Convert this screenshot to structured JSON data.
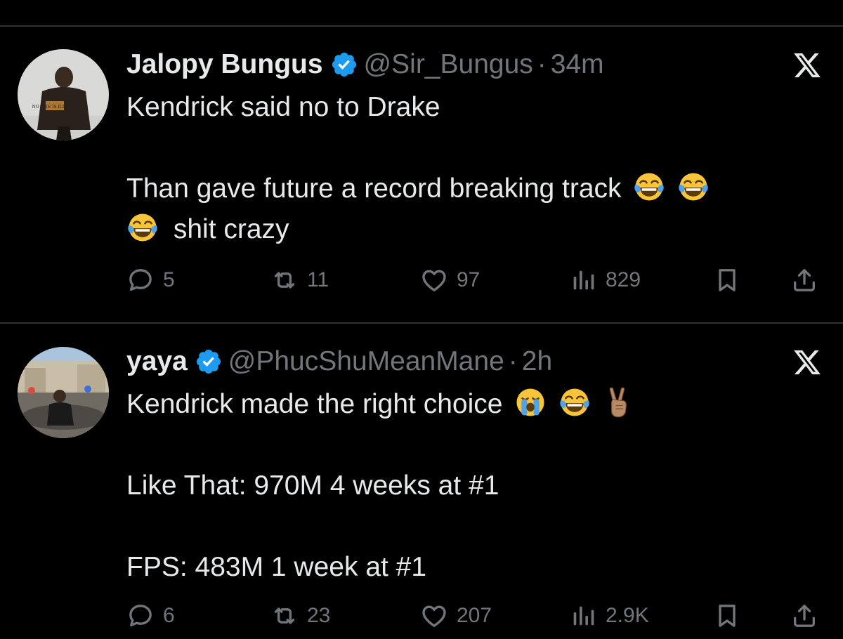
{
  "tweets": [
    {
      "name": "Jalopy Bungus",
      "handle": "@Sir_Bungus",
      "separator": "·",
      "time": "34m",
      "avatar_hoodie_text": "NO ONE IS ILLEGAL",
      "lines": {
        "l1": "Kendrick said no to Drake",
        "l2": "Than gave future a record breaking track",
        "l3": "shit crazy"
      },
      "emojis": [
        "face-with-tears-of-joy",
        "face-with-tears-of-joy",
        "face-with-tears-of-joy"
      ],
      "stats": {
        "replies": "5",
        "retweets": "11",
        "likes": "97",
        "views": "829"
      }
    },
    {
      "name": "yaya",
      "handle": "@PhucShuMeanMane",
      "separator": "·",
      "time": "2h",
      "lines": {
        "l1": "Kendrick made the right choice",
        "l2": "Like That: 970M 4 weeks at #1",
        "l3": "FPS: 483M 1 week at #1"
      },
      "emojis": [
        "loudly-crying-face",
        "face-with-tears-of-joy",
        "victory-hand"
      ],
      "stats": {
        "replies": "6",
        "retweets": "23",
        "likes": "207",
        "views": "2.9K"
      }
    }
  ],
  "icons": [
    "verified-badge-icon",
    "x-logo-icon",
    "reply-icon",
    "retweet-icon",
    "like-icon",
    "views-icon",
    "bookmark-icon",
    "share-icon"
  ],
  "colors": {
    "background": "#000000",
    "text": "#e7e9ea",
    "muted": "#71767b",
    "divider": "#2f3336",
    "verified": "#1d9bf0"
  }
}
